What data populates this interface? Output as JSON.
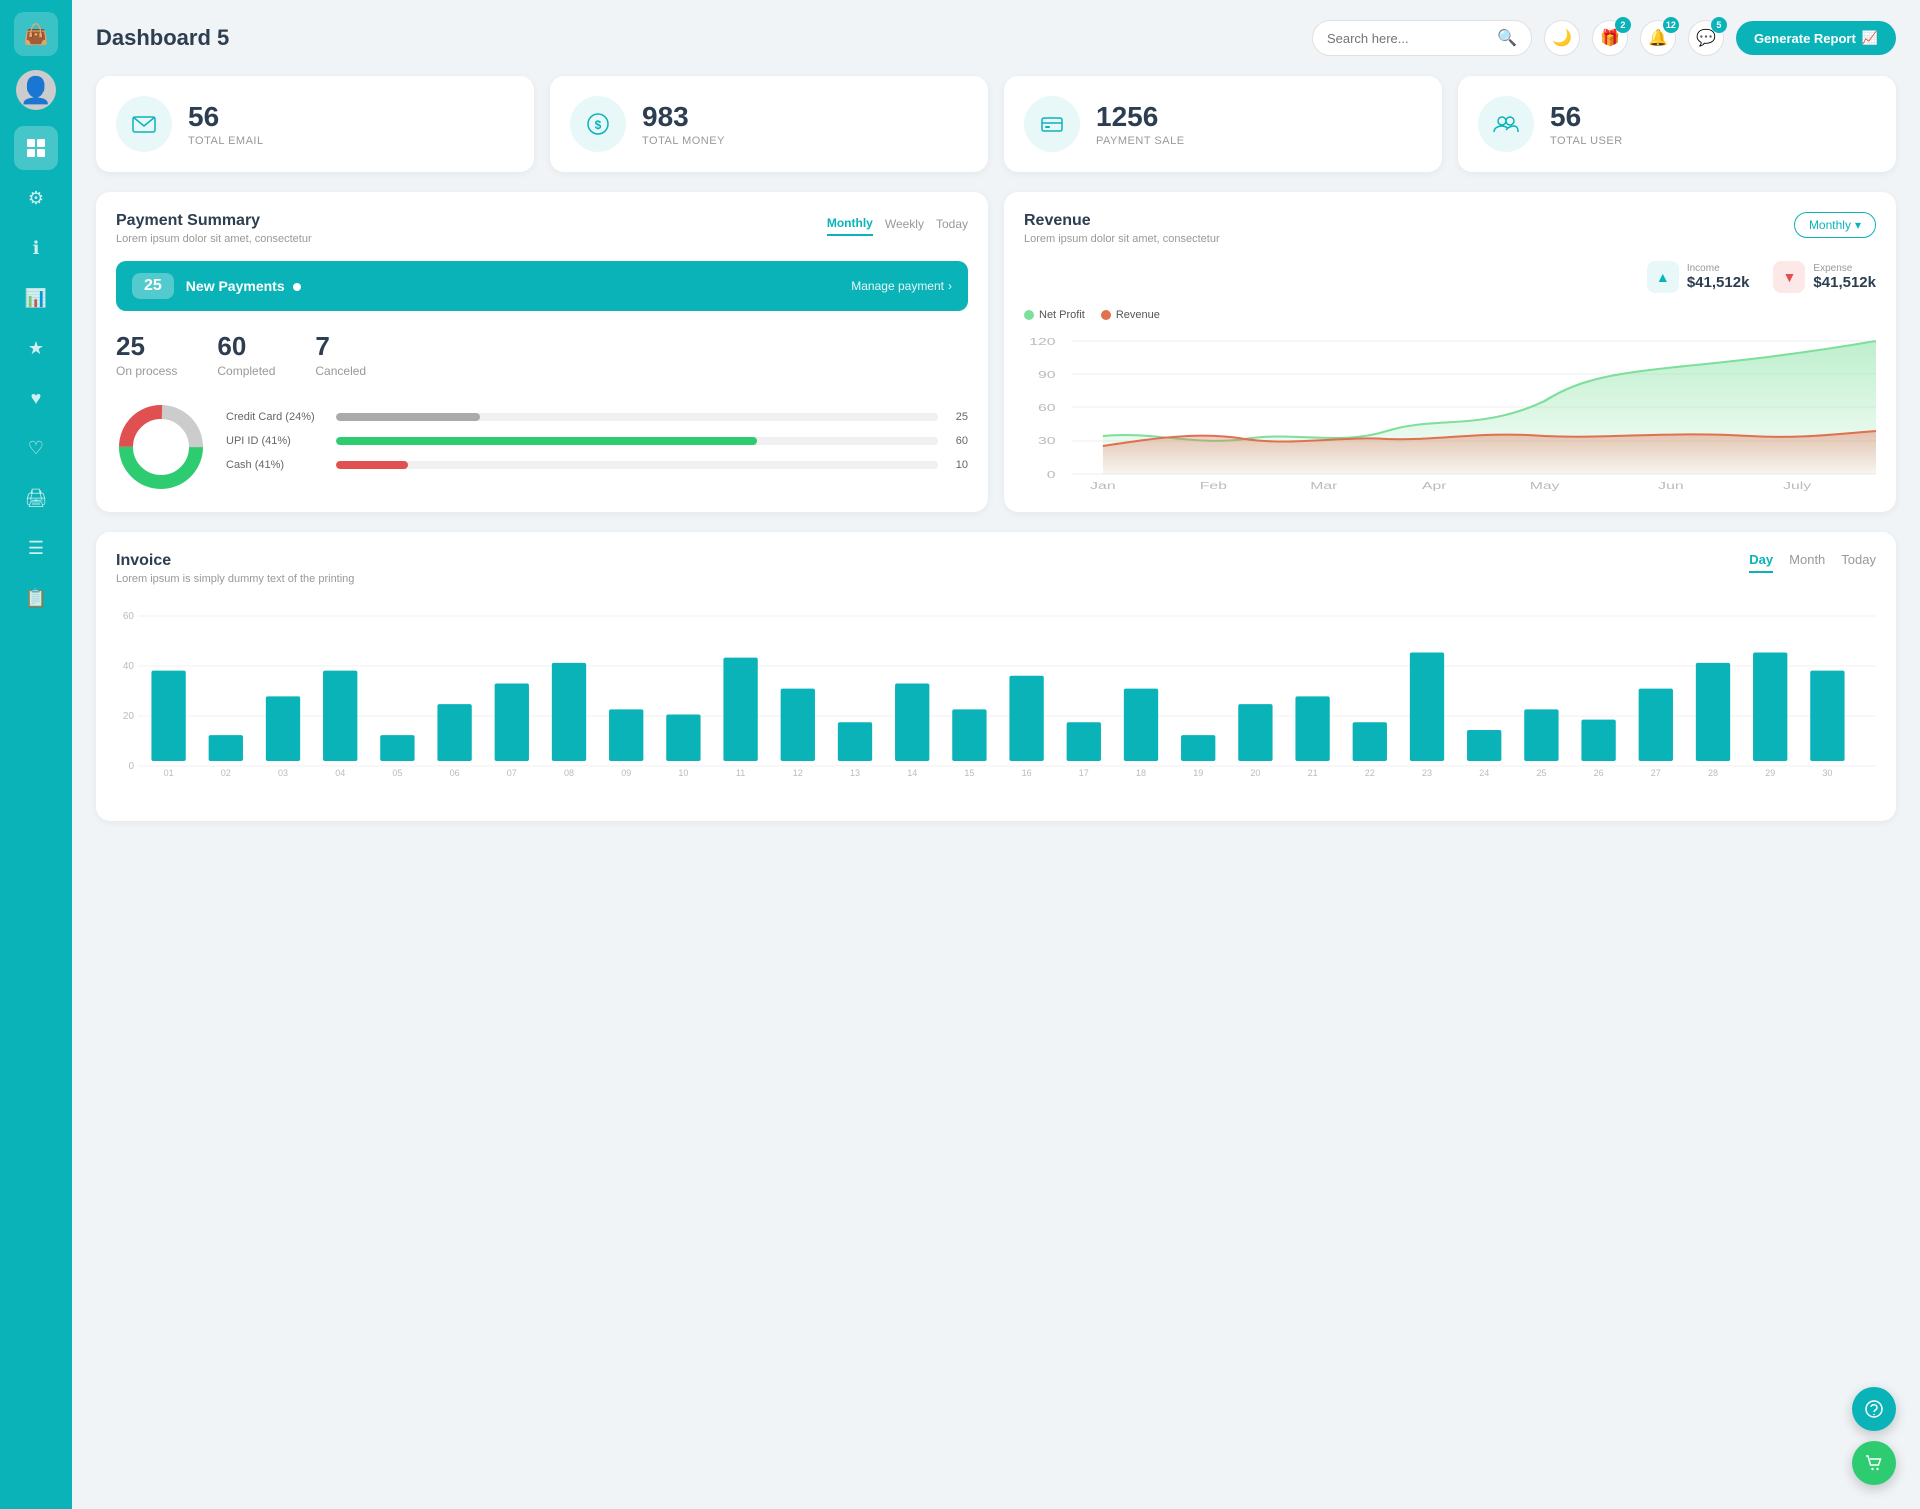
{
  "app": {
    "title": "Dashboard 5"
  },
  "header": {
    "search_placeholder": "Search here...",
    "generate_btn": "Generate Report",
    "badges": {
      "gift": "2",
      "bell": "12",
      "chat": "5"
    }
  },
  "stats": [
    {
      "id": "email",
      "number": "56",
      "label": "TOTAL EMAIL",
      "icon": "✉"
    },
    {
      "id": "money",
      "number": "983",
      "label": "TOTAL MONEY",
      "icon": "$"
    },
    {
      "id": "payment",
      "number": "1256",
      "label": "PAYMENT SALE",
      "icon": "💳"
    },
    {
      "id": "user",
      "number": "56",
      "label": "TOTAL USER",
      "icon": "👥"
    }
  ],
  "payment_summary": {
    "title": "Payment Summary",
    "subtitle": "Lorem ipsum dolor sit amet, consectetur",
    "tabs": [
      "Monthly",
      "Weekly",
      "Today"
    ],
    "active_tab": "Monthly",
    "new_payments_count": "25",
    "new_payments_label": "New Payments",
    "manage_link": "Manage payment",
    "on_process": "25",
    "on_process_label": "On process",
    "completed": "60",
    "completed_label": "Completed",
    "canceled": "7",
    "canceled_label": "Canceled",
    "bars": [
      {
        "label": "Credit Card (24%)",
        "pct": 24,
        "color": "#aaa",
        "val": "25"
      },
      {
        "label": "UPI ID (41%)",
        "pct": 70,
        "color": "#2ecc71",
        "val": "60"
      },
      {
        "label": "Cash (41%)",
        "pct": 12,
        "color": "#e05050",
        "val": "10"
      }
    ],
    "donut": {
      "gray_pct": 25,
      "green_pct": 50,
      "red_pct": 25
    }
  },
  "revenue": {
    "title": "Revenue",
    "subtitle": "Lorem ipsum dolor sit amet, consectetur",
    "monthly_btn": "Monthly",
    "income_label": "Income",
    "income_val": "$41,512k",
    "expense_label": "Expense",
    "expense_val": "$41,512k",
    "legend": [
      {
        "label": "Net Profit",
        "color": "#7ddf9b"
      },
      {
        "label": "Revenue",
        "color": "#e07050"
      }
    ],
    "y_labels": [
      "120",
      "90",
      "60",
      "30",
      "0"
    ],
    "x_labels": [
      "Jan",
      "Feb",
      "Mar",
      "Apr",
      "May",
      "Jun",
      "July"
    ]
  },
  "invoice": {
    "title": "Invoice",
    "subtitle": "Lorem ipsum is simply dummy text of the printing",
    "tabs": [
      "Day",
      "Month",
      "Today"
    ],
    "active_tab": "Day",
    "y_labels": [
      "60",
      "40",
      "20",
      "0"
    ],
    "x_labels": [
      "01",
      "02",
      "03",
      "04",
      "05",
      "06",
      "07",
      "08",
      "09",
      "10",
      "11",
      "12",
      "13",
      "14",
      "15",
      "16",
      "17",
      "18",
      "19",
      "20",
      "21",
      "22",
      "23",
      "24",
      "25",
      "26",
      "27",
      "28",
      "29",
      "30"
    ],
    "bars": [
      35,
      10,
      25,
      35,
      10,
      22,
      30,
      38,
      20,
      18,
      40,
      28,
      15,
      30,
      20,
      33,
      15,
      28,
      10,
      22,
      25,
      15,
      42,
      12,
      20,
      16,
      28,
      38,
      42,
      35
    ]
  },
  "sidebar": {
    "items": [
      {
        "id": "wallet",
        "icon": "👜",
        "active": false
      },
      {
        "id": "dashboard",
        "icon": "▦",
        "active": true
      },
      {
        "id": "settings",
        "icon": "⚙",
        "active": false
      },
      {
        "id": "info",
        "icon": "ℹ",
        "active": false
      },
      {
        "id": "chart",
        "icon": "📊",
        "active": false
      },
      {
        "id": "star",
        "icon": "★",
        "active": false
      },
      {
        "id": "heart",
        "icon": "♥",
        "active": false
      },
      {
        "id": "heart2",
        "icon": "♥",
        "active": false
      },
      {
        "id": "print",
        "icon": "🖨",
        "active": false
      },
      {
        "id": "list",
        "icon": "☰",
        "active": false
      },
      {
        "id": "doc",
        "icon": "📄",
        "active": false
      }
    ]
  }
}
